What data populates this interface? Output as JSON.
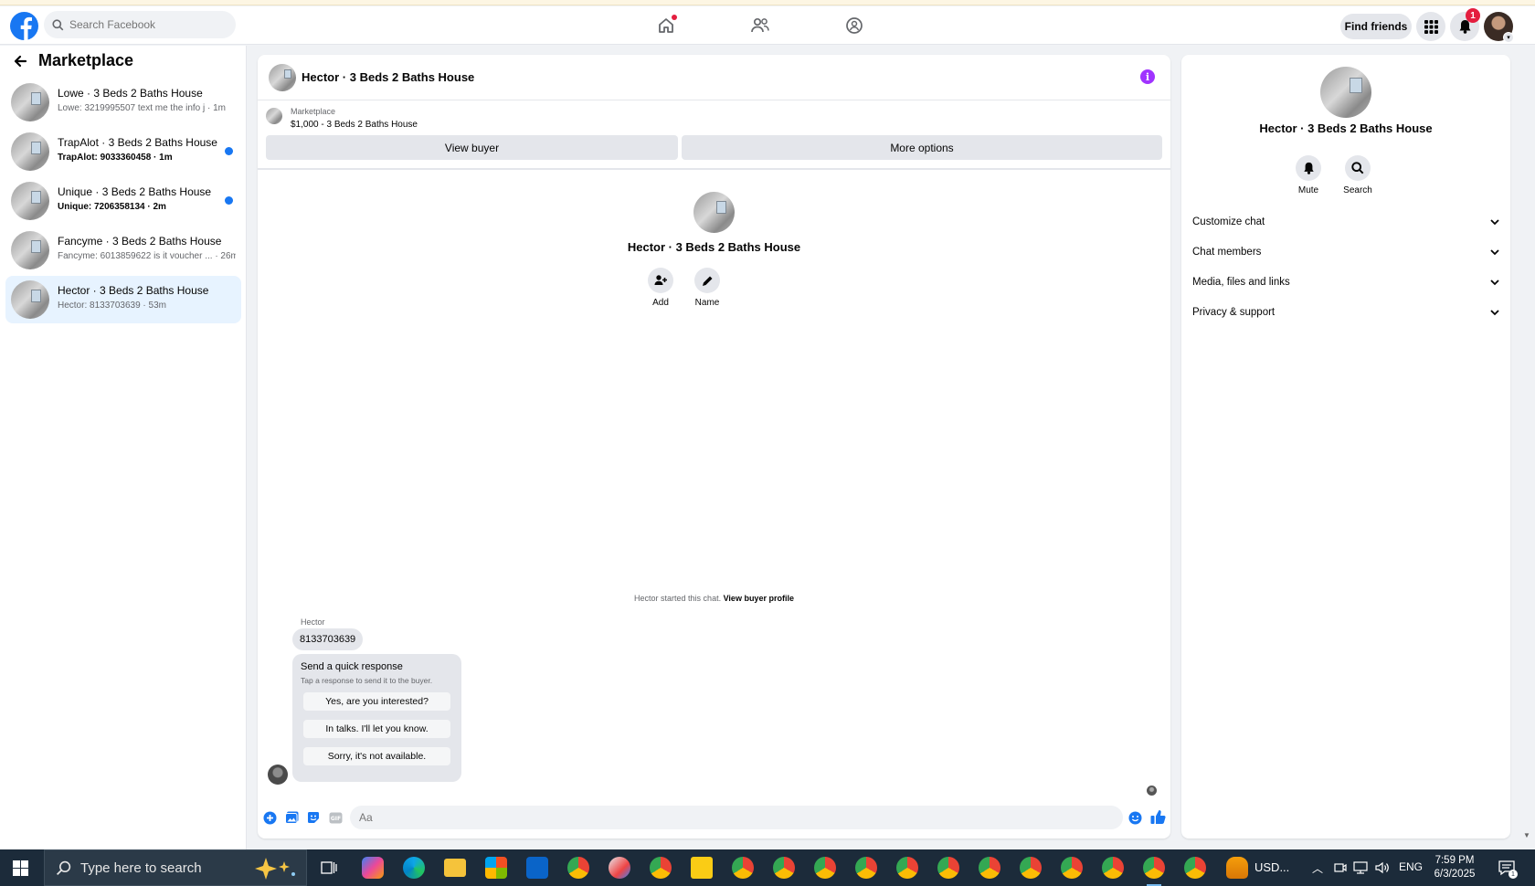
{
  "header": {
    "search_placeholder": "Search Facebook",
    "find_friends_label": "Find friends",
    "notification_count": "1",
    "icons": [
      "facebook-logo-icon",
      "home-icon",
      "friends-icon",
      "groups-icon",
      "menu-grid-icon",
      "bell-icon"
    ]
  },
  "sidebar": {
    "title": "Marketplace",
    "conversations": [
      {
        "title": "Lowe · 3 Beds 2 Baths House",
        "subtitle": "Lowe: 3219995507 text me the info j · 1m",
        "unread": false
      },
      {
        "title": "TrapAlot · 3 Beds 2 Baths House",
        "subtitle": "TrapAlot: 9033360458 · 1m",
        "unread": true
      },
      {
        "title": "Unique · 3 Beds 2 Baths House",
        "subtitle": "Unique: 7206358134 · 2m",
        "unread": true
      },
      {
        "title": "Fancyme · 3 Beds 2 Baths House",
        "subtitle": "Fancyme: 6013859622 is it voucher ... · 26m",
        "unread": false
      },
      {
        "title": "Hector · 3 Beds 2 Baths House",
        "subtitle": "Hector: 8133703639 · 53m",
        "unread": false,
        "active": true
      }
    ]
  },
  "chat": {
    "title": "Hector · 3 Beds 2 Baths House",
    "listing_label": "Marketplace",
    "listing_price": "$1,000 - 3 Beds 2 Baths House",
    "view_buyer_label": "View buyer",
    "more_options_label": "More options",
    "profile_name": "Hector · 3 Beds 2 Baths House",
    "add_label": "Add",
    "name_label": "Name",
    "started_text": "Hector started this chat.",
    "view_profile_link": "View buyer profile",
    "sender_name": "Hector",
    "message": "8133703639",
    "quick_title": "Send a quick response",
    "quick_subtitle": "Tap a response to send it to the buyer.",
    "quick_responses": [
      "Yes, are you interested?",
      "In talks. I'll let you know.",
      "Sorry, it's not available."
    ],
    "composer_placeholder": "Aa"
  },
  "info_panel": {
    "name": "Hector · 3 Beds 2 Baths House",
    "mute_label": "Mute",
    "search_label": "Search",
    "sections": [
      "Customize chat",
      "Chat members",
      "Media, files and links",
      "Privacy & support"
    ]
  },
  "taskbar": {
    "search_placeholder": "Type here to search",
    "currency_text": "USD...",
    "language": "ENG",
    "time": "7:59 PM",
    "date": "6/3/2025"
  }
}
